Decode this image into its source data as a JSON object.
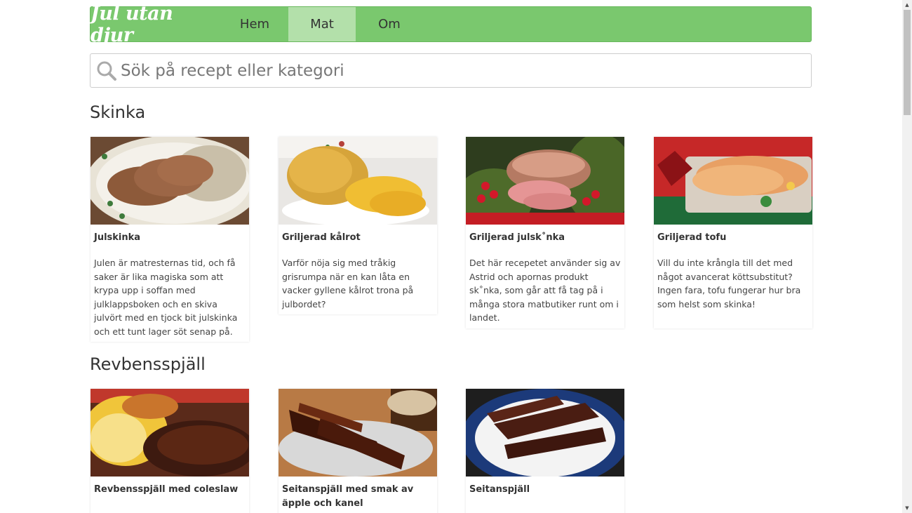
{
  "nav": {
    "brand": "Jul utan djur",
    "items": [
      {
        "label": "Hem",
        "active": false
      },
      {
        "label": "Mat",
        "active": true
      },
      {
        "label": "Om",
        "active": false
      }
    ]
  },
  "search": {
    "placeholder": "Sök på recept eller kategori",
    "icon": "search-icon"
  },
  "sections": [
    {
      "title": "Skinka",
      "cards": [
        {
          "title": "Julskinka",
          "text": "Julen är matresternas tid, och få saker är lika magiska som att krypa upp i soffan med julklappsboken och en skiva julvört med en tjock bit julskinka och ett tunt lager söt senap på."
        },
        {
          "title": "Griljerad kålrot",
          "text": "Varför nöja sig med tråkig grisrumpa när en kan låta en vacker gyllene kålrot trona på julbordet?"
        },
        {
          "title": "Griljerad julsk˚nka",
          "text": "Det här recepetet använder sig av Astrid och apornas produkt sk˚nka, som går att få tag på i många stora matbutiker runt om i landet."
        },
        {
          "title": "Griljerad tofu",
          "text": "Vill du inte krångla till det med något avancerat köttsubstitut? Ingen fara, tofu fungerar hur bra som helst som skinka!"
        }
      ]
    },
    {
      "title": "Revbensspjäll",
      "cards": [
        {
          "title": "Revbensspjäll med coleslaw",
          "text": ""
        },
        {
          "title": "Seitanspjäll med smak av äpple och kanel",
          "text": ""
        },
        {
          "title": "Seitanspjäll",
          "text": ""
        }
      ]
    }
  ],
  "colors": {
    "navbar": "#7ac86e",
    "nav_active": "#b3e0aa",
    "brand_text": "#ffffff"
  }
}
